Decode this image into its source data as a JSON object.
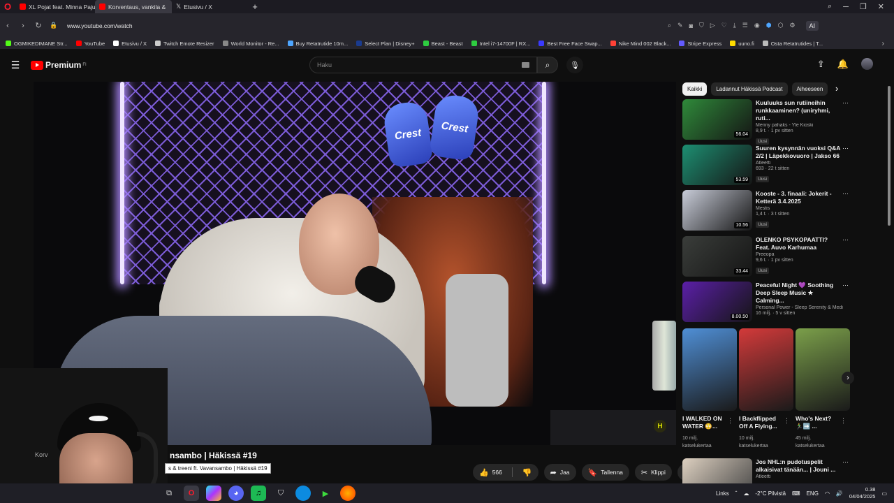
{
  "browser": {
    "tabs": [
      {
        "label": "XL Pojat feat. Minna Paju",
        "color": "#ff0000",
        "active": false
      },
      {
        "label": "Korventaus, vankila &",
        "color": "#ff0000",
        "active": true
      },
      {
        "label": "Etusivu / X",
        "color": "#ffffff",
        "active": false
      }
    ],
    "new_tab": "+",
    "url": "www.youtube.com/watch",
    "ai_label": "AI",
    "bookmarks": [
      {
        "label": "OGMIKEDIMANE Str...",
        "color": "#53fc18"
      },
      {
        "label": "YouTube",
        "color": "#ff0000"
      },
      {
        "label": "Etusivu / X",
        "color": "#ffffff"
      },
      {
        "label": "Twitch Emote Resizer",
        "color": "#cccccc"
      },
      {
        "label": "World Monitor - Re...",
        "color": "#888888"
      },
      {
        "label": "Buy Retatrutide 10m...",
        "color": "#4ea6ff"
      },
      {
        "label": "Select Plan | Disney+",
        "color": "#1a3b8f"
      },
      {
        "label": "Beast - Beast",
        "color": "#2ecc40"
      },
      {
        "label": "Intel i7-14700F | RX...",
        "color": "#2ecc40"
      },
      {
        "label": "Best Free Face Swap...",
        "color": "#3a3aff"
      },
      {
        "label": "Nike Mind 002 Black...",
        "color": "#ff4136"
      },
      {
        "label": "Stripe Express",
        "color": "#635bff"
      },
      {
        "label": "uuno.fi",
        "color": "#ffdc00"
      },
      {
        "label": "Osta Retatrutides | T...",
        "color": "#bbbbbb"
      }
    ]
  },
  "youtube": {
    "logo_text": "Premium",
    "logo_sup": "FI",
    "search_placeholder": "Haku",
    "video_title": "nsambo | Häkissä #19",
    "video_tooltip": "s & treeni ft. Vavansambo | Häkissä #19",
    "channel_partial": "Korv",
    "glove_text": "Crest",
    "actions": {
      "likes": "566",
      "share": "Jaa",
      "save": "Tallenna",
      "clip": "Klippi"
    },
    "chips": [
      {
        "label": "Kaikki",
        "selected": true
      },
      {
        "label": "Ladannut Häkissä Podcast",
        "selected": false
      },
      {
        "label": "Aiheeseen",
        "selected": false
      }
    ],
    "recommendations": [
      {
        "title": "Kuuluuks sun rutiineihin runkkaaminen? (uniryhmi, ruti...",
        "channel": "Menny pahaks - Yle Kioski",
        "meta": "8,9 t.  ·  1 pv sitten",
        "badge": "Uusi",
        "duration": "56.04",
        "color": "#2f8a3a"
      },
      {
        "title": "Suuren kysynnän vuoksi Q&A 2/2 | Läpekkovuoro | Jakso 66",
        "channel": "Atleetti",
        "meta": "693  ·  22 t sitten",
        "badge": "Uusi",
        "duration": "53.59",
        "color": "#1d8f72"
      },
      {
        "title": "Kooste - 3. finaali: Jokerit - Ketterä 3.4.2025",
        "channel": "Mestis",
        "meta": "1,4 t.  ·  3 t sitten",
        "badge": "Uusi",
        "duration": "10.56",
        "color": "#c8ccd8"
      },
      {
        "title": "OLENKO PSYKOPAATTI? Feat. Auvo Karhumaa",
        "channel": "Preeopa",
        "meta": "9,6 t.  ·  1 pv sitten",
        "badge": "Uusi",
        "duration": "33.44",
        "color": "#3a3d3a"
      },
      {
        "title": "Peaceful Night 💜 Soothing Deep Sleep Music ★ Calming...",
        "channel": "Personal Power - Sleep Serenity & Medit",
        "meta": "16 milj.  ·  5 v sitten",
        "badge": "",
        "duration": "8.00.50",
        "color": "#5b1fa8"
      }
    ],
    "shorts": [
      {
        "title": "I WALKED ON WATER 😳...",
        "views": "10 milj.",
        "views_label": "katselukertaa",
        "color": "#4f8fd6"
      },
      {
        "title": "I Backflipped Off A Flying...",
        "views": "10 milj.",
        "views_label": "katselukertaa",
        "color": "#d33a3a"
      },
      {
        "title": "Who's Next? 🏃‍♂️➡️ ...",
        "views": "45 milj.",
        "views_label": "katselukertaa",
        "color": "#7b9f4a"
      }
    ],
    "bottom_rec": {
      "title": "Jos NHL:n pudotuspelit alkaisivat tänään... | Jouni ...",
      "channel": "Atleetti",
      "color": "#ddd0c0"
    }
  },
  "taskbar": {
    "links": "Links",
    "weather": "-2°C  Pilvistä",
    "lang": "ENG",
    "time": "0.38",
    "date": "04/04/2025"
  }
}
